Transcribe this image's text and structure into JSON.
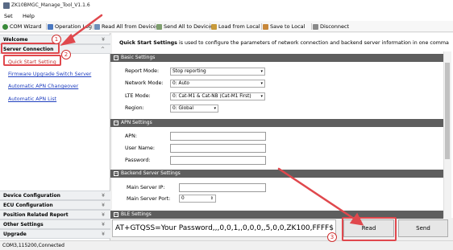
{
  "window": {
    "title": "ZK10BMGC_Manage_Tool_V1.1.6"
  },
  "menu": {
    "setup": "Set",
    "help": "Help"
  },
  "toolbar": {
    "com_wizard": "COM Wizard",
    "operation_log": "Operation Log",
    "read_all": "Read All from Device",
    "send_all": "Send All to Device",
    "load_local": "Load from Local",
    "save_local": "Save to Local",
    "disconnect": "Disconnect"
  },
  "sidebar": {
    "welcome": "Welcome",
    "server_connection": "Server Connection",
    "links": [
      "Quick Start Setting",
      "Firmware Upgrade Switch Server",
      "Automatic APN Changeover",
      "Automatic APN List"
    ],
    "bottom": [
      "Device Configuration",
      "ECU Configuration",
      "Position Related Report",
      "Other Settings",
      "Upgrade"
    ]
  },
  "intro": {
    "bold": "Quick Start Settings",
    "rest": " is used to configure the parameters of network connection and backend server information in one comma"
  },
  "basic": {
    "heading": "Basic Settings",
    "report_mode_label": "Report Mode:",
    "report_mode_value": "Stop reporting",
    "network_mode_label": "Network Mode:",
    "network_mode_value": "0: Auto",
    "lte_mode_label": "LTE Mode:",
    "lte_mode_value": "0: Cat-M1 & Cat-NB (Cat-M1 First)",
    "region_label": "Region:",
    "region_value": "0: Global"
  },
  "apn": {
    "heading": "APN Settings",
    "apn_label": "APN:",
    "username_label": "User Name:",
    "password_label": "Password:"
  },
  "backend": {
    "heading": "Backend Server Settings",
    "ip_label": "Main Server IP:",
    "port_label": "Main Server Port:",
    "port_value": "0"
  },
  "ble": {
    "heading": "BLE Settings"
  },
  "command": {
    "text": "AT+GTQSS=Your Password,,,0,0,1,,0,0,0,,5,0,0,ZK100,FFFF$"
  },
  "buttons": {
    "read": "Read",
    "send": "Send"
  },
  "status": {
    "text": "COM3,115200,Connected"
  },
  "annotations": [
    "1",
    "2",
    "3"
  ],
  "colors": {
    "annotation_red": "#e0484d",
    "link_blue": "#1f3fbf",
    "section_band": "#5e5e5e"
  }
}
